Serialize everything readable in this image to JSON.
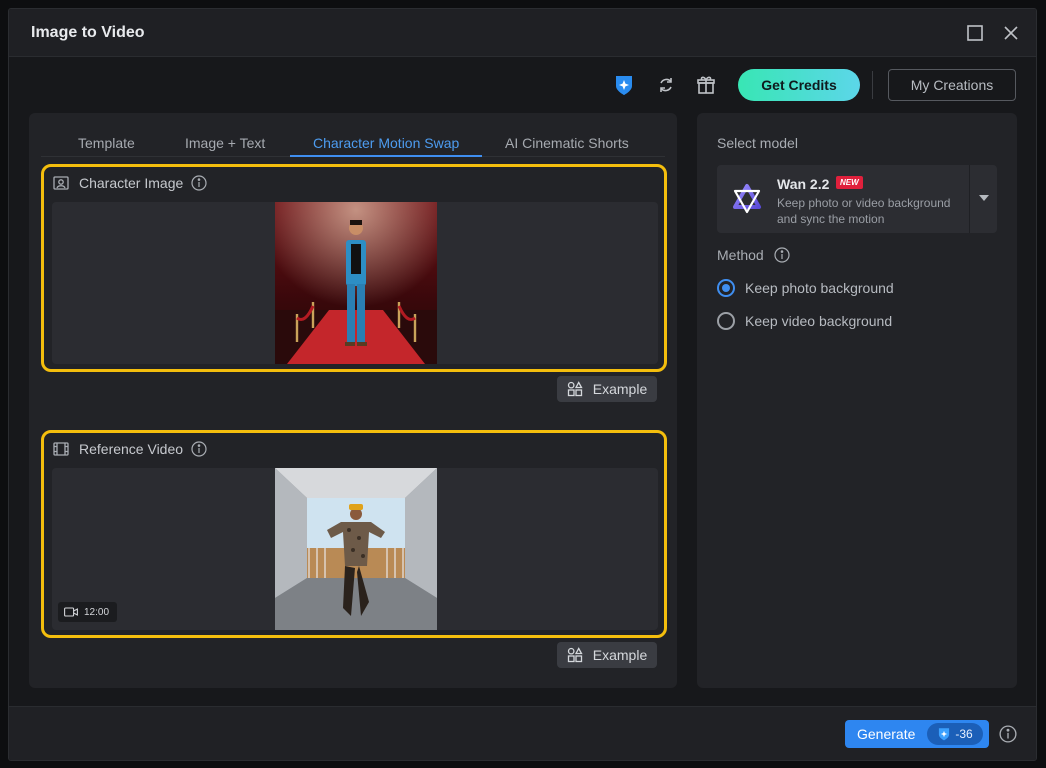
{
  "window": {
    "title": "Image to Video"
  },
  "toolbar": {
    "get_credits": "Get Credits",
    "my_creations": "My Creations"
  },
  "tabs": [
    {
      "label": "Template",
      "active": false
    },
    {
      "label": "Image + Text",
      "active": false
    },
    {
      "label": "Character Motion Swap",
      "active": true
    },
    {
      "label": "AI Cinematic Shorts",
      "active": false
    }
  ],
  "character_image": {
    "label": "Character Image",
    "example": "Example"
  },
  "reference_video": {
    "label": "Reference Video",
    "duration": "12:00",
    "example": "Example"
  },
  "model": {
    "section_label": "Select model",
    "name": "Wan 2.2",
    "badge": "NEW",
    "description": "Keep photo or video background and sync the motion"
  },
  "method": {
    "label": "Method",
    "options": [
      {
        "label": "Keep photo background",
        "checked": true
      },
      {
        "label": "Keep video background",
        "checked": false
      }
    ]
  },
  "footer": {
    "generate": "Generate",
    "cost": "-36"
  },
  "colors": {
    "accent": "#3f8ef0",
    "highlight": "#f4be0d",
    "credits_start": "#38e6b4",
    "credits_end": "#5cd6e9",
    "new_badge": "#e0203c"
  }
}
